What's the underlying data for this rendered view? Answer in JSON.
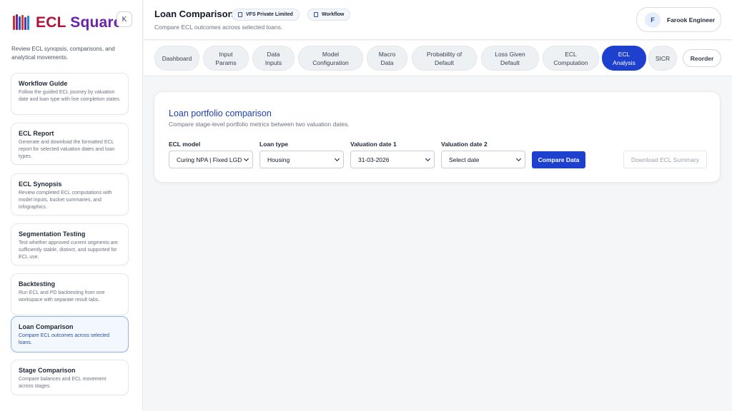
{
  "brand": {
    "name_part1": "ECL",
    "name_part2": "Square",
    "logo_icon": "bar-logo-icon",
    "collapse_label": "K"
  },
  "sidebar": {
    "description": "Review ECL synopsis, comparisons, and analytical movements.",
    "items": [
      {
        "title": "Workflow Guide",
        "text": "Follow the guided ECL journey by valuation date and loan type with live completion states."
      },
      {
        "title": "ECL Report",
        "text": "Generate and download the formatted ECL report for selected valuation dates and loan types."
      },
      {
        "title": "ECL Synopsis",
        "text": "Review completed ECL computations with model inputs, bucket summaries, and infographics."
      },
      {
        "title": "Segmentation Testing",
        "text": "Test whether approved current segments are sufficiently stable, distinct, and supported for ECL use."
      },
      {
        "title": "Backtesting",
        "text": "Run ECL and PD backtesting from one workspace with separate result tabs."
      },
      {
        "title": "Loan Comparison",
        "text": "Compare ECL outcomes across selected loans."
      },
      {
        "title": "Stage Comparison",
        "text": "Compare balances and ECL movement across stages."
      }
    ]
  },
  "header": {
    "title": "Loan Comparison",
    "org_pill": "VFS Private Limited",
    "workflow_pill": "Workflow",
    "subtitle": "Compare ECL outcomes across selected loans.",
    "user_initial": "F",
    "user_name": "Farook Engineer"
  },
  "tabs": [
    {
      "label": "Dashboard"
    },
    {
      "label": "Input Params"
    },
    {
      "label": "Data Inputs"
    },
    {
      "label": "Model Configuration"
    },
    {
      "label": "Macro Data"
    },
    {
      "label": "Probability of Default"
    },
    {
      "label": "Loss Given Default"
    },
    {
      "label": "ECL Computation"
    },
    {
      "label": "ECL Analysis"
    },
    {
      "label": "SICR"
    }
  ],
  "reorder_label": "Reorder",
  "card": {
    "title": "Loan portfolio comparison",
    "subtitle": "Compare stage-level portfolio metrics between two valuation dates.",
    "fields": {
      "ecl_model": {
        "label": "ECL model",
        "value": "Curing NPA | Fixed LGD"
      },
      "loan_type": {
        "label": "Loan type",
        "value": "Housing"
      },
      "valuation_date_1": {
        "label": "Valuation date 1",
        "value": "31-03-2026"
      },
      "valuation_date_2": {
        "label": "Valuation date 2",
        "value": "Select date"
      }
    },
    "compare_button": "Compare Data",
    "download_button": "Download ECL Summary"
  },
  "colors": {
    "accent": "#1e40cf",
    "brand_red": "#b0123a",
    "brand_purple": "#6b21a8"
  }
}
